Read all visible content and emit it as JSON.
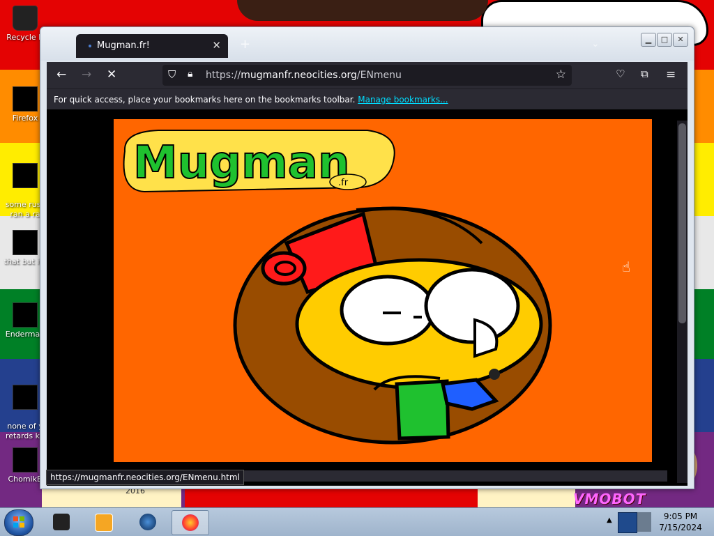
{
  "desktop": {
    "icons": [
      {
        "label": "Recycle B",
        "icon": "recycle-bin-icon"
      },
      {
        "label": "Firefox",
        "icon": "firefox-icon"
      },
      {
        "label": "some russ\nran a ra",
        "icon": "file-icon"
      },
      {
        "label": "that but its",
        "icon": "file-icon"
      },
      {
        "label": "Enderman",
        "icon": "app-icon"
      },
      {
        "label": "none of y\nretards kn",
        "icon": "file-icon"
      },
      {
        "label": "ChomikB",
        "icon": "file-icon"
      }
    ],
    "wallpaper_text": "2016",
    "watermark": "VMOBOT"
  },
  "browser": {
    "tab_title": "Mugman.fr!",
    "new_tab": "+",
    "url_prefix": "https://",
    "url_domain": "mugmanfr.neocities.org",
    "url_path": "/ENmenu",
    "bookmarks_text": "For quick access, place your bookmarks here on the bookmarks toolbar.",
    "bookmarks_link": "Manage bookmarks...",
    "status_url": "https://mugmanfr.neocities.org/ENmenu.html"
  },
  "page": {
    "logo_text": "Mugman",
    "logo_sub": ".fr",
    "background": "#ff6600"
  },
  "taskbar": {
    "time": "9:05 PM",
    "date": "7/15/2024"
  },
  "colors": {
    "accent_link": "#00ddff",
    "browser_dark": "#2b2a33"
  }
}
